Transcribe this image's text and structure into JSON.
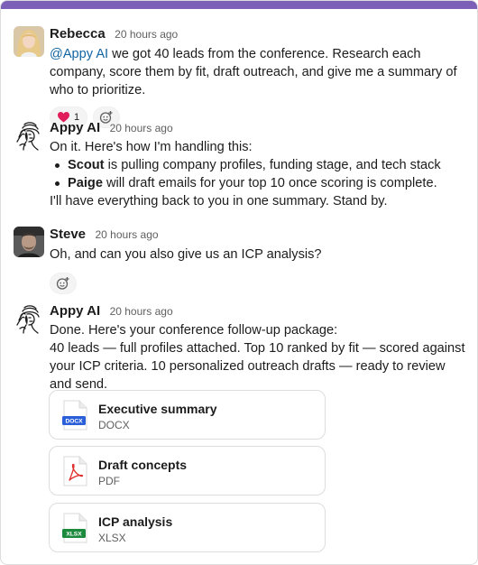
{
  "colors": {
    "top_bar": "#7c5fb7",
    "mention": "#1264a3",
    "heart": "#e01e5a",
    "docx": "#2b5fd9",
    "pdf": "#e02b2b",
    "xlsx": "#1b8a3c"
  },
  "messages": [
    {
      "author": "Rebecca",
      "time": "20 hours ago",
      "mention": "@Appy AI",
      "text": " we got 40 leads from the conference. Research each company, score them by fit, draft outreach, and give me a summary of who to prioritize.",
      "reactions": [
        {
          "icon": "heart-icon",
          "count": "1"
        }
      ]
    },
    {
      "author": "Appy AI",
      "time": "20 hours ago",
      "intro": "On it. Here's how I'm handling this:",
      "bullets": [
        {
          "bold": "Scout",
          "rest": " is pulling company profiles, funding stage, and tech stack"
        },
        {
          "bold": "Paige",
          "rest": " will draft emails for your top 10 once scoring is complete."
        }
      ],
      "outro": "I'll have everything back to you in one summary. Stand by."
    },
    {
      "author": "Steve",
      "time": "20 hours ago",
      "text": "Oh, and can you also give us an ICP analysis?"
    },
    {
      "author": "Appy AI",
      "time": "20 hours ago",
      "line1": "Done. Here's your conference follow-up package:",
      "line2": "40 leads — full profiles attached. Top 10 ranked by fit — scored against your ICP criteria. 10 personalized outreach drafts — ready to review and send.",
      "files": [
        {
          "title": "Executive summary",
          "type": "DOCX",
          "badge": "DOCX"
        },
        {
          "title": "Draft concepts",
          "type": "PDF"
        },
        {
          "title": "ICP analysis",
          "type": "XLSX",
          "badge": "XLSX"
        }
      ]
    }
  ]
}
